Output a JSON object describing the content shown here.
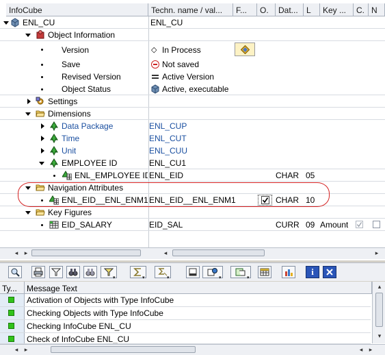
{
  "tree": {
    "columns": [
      "InfoCube",
      "Techn. name / val...",
      "F...",
      "O.",
      "Dat...",
      "L",
      "Key ...",
      "C.",
      "N"
    ],
    "rows": [
      {
        "key": "enl_cu",
        "label": "ENL_CU",
        "tech": "ENL_CU"
      },
      {
        "key": "obj_info",
        "label": "Object Information"
      },
      {
        "key": "version",
        "label": "Version",
        "tech": "In Process"
      },
      {
        "key": "save",
        "label": "Save",
        "tech": "Not saved"
      },
      {
        "key": "revised",
        "label": "Revised Version",
        "tech": "Active Version"
      },
      {
        "key": "status",
        "label": "Object Status",
        "tech": "Active, executable"
      },
      {
        "key": "settings",
        "label": "Settings"
      },
      {
        "key": "dimensions",
        "label": "Dimensions"
      },
      {
        "key": "data_package",
        "label": "Data Package",
        "tech": "ENL_CUP"
      },
      {
        "key": "time",
        "label": "Time",
        "tech": "ENL_CUT"
      },
      {
        "key": "unit",
        "label": "Unit",
        "tech": "ENL_CUU"
      },
      {
        "key": "employee",
        "label": "EMPLOYEE ID",
        "tech": "ENL_CU1"
      },
      {
        "key": "enl_employee",
        "label": "ENL_EMPLOYEE ID",
        "tech": "ENL_EID",
        "dtype": "CHAR",
        "len": "05"
      },
      {
        "key": "nav_attr",
        "label": "Navigation Attributes"
      },
      {
        "key": "enl_eid_enm1",
        "label": "ENL_EID__ENL_ENM1",
        "tech": "ENL_EID__ENL_ENM1",
        "dtype": "CHAR",
        "len": "10",
        "checked": true
      },
      {
        "key": "key_figures",
        "label": "Key Figures"
      },
      {
        "key": "eid_salary",
        "label": "EID_SALARY",
        "tech": "EID_SAL",
        "dtype": "CURR",
        "len": "09",
        "keyfig": "Amount"
      }
    ]
  },
  "scroll": {
    "left": "◂",
    "right": "▸",
    "up": "▴",
    "down": "▾"
  },
  "toolbar": {
    "buttons": [
      "find-icon",
      "print-icon",
      "filter-icon",
      "binoculars-icon",
      "binoculars-next-icon",
      "filter-dropdown-icon",
      "sum-icon",
      "subtotal-icon",
      "print-preview-icon",
      "export-icon",
      "spreadsheet-icon",
      "layout-grid-icon",
      "graphic-icon",
      "info-icon",
      "close-icon"
    ]
  },
  "messages": {
    "columns": [
      "Ty...",
      "Message Text"
    ],
    "rows": [
      {
        "text": "Activation of Objects with Type InfoCube",
        "status": "success"
      },
      {
        "text": "Checking Objects with Type InfoCube",
        "status": "success"
      },
      {
        "text": "Checking InfoCube ENL_CU",
        "status": "success"
      },
      {
        "text": "Check of InfoCube ENL_CU",
        "status": "success"
      }
    ]
  },
  "colors": {
    "highlight": "#d42020",
    "success": "#31c31a",
    "link": "#1a4fa0"
  }
}
